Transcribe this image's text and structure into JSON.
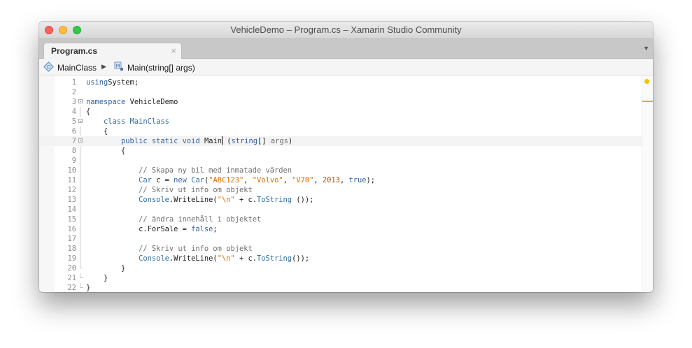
{
  "window": {
    "title": "VehicleDemo – Program.cs – Xamarin Studio Community"
  },
  "tabs": [
    {
      "label": "Program.cs",
      "close": "×"
    }
  ],
  "tab_overflow": "▼",
  "pathbar": {
    "class_name": "MainClass",
    "separator": "▶",
    "method_name": "Main(string[] args)"
  },
  "colors": {
    "keyword": "#3364a4",
    "string": "#db7100",
    "comment": "#6f6f6f",
    "line_number": "#8f8f8f"
  },
  "icons": [
    "close-icon",
    "minimize-icon",
    "zoom-icon",
    "class-icon",
    "method-icon",
    "fold-icon",
    "chevron-down-icon"
  ],
  "editor": {
    "cursor_line": 7,
    "lines": [
      {
        "n": "1",
        "tokens": [
          [
            "kw",
            "using"
          ],
          [
            "",
            "System;"
          ]
        ]
      },
      {
        "n": "2",
        "tokens": []
      },
      {
        "n": "3",
        "tokens": [
          [
            "kw",
            "namespace"
          ],
          [
            "",
            " VehicleDemo"
          ]
        ]
      },
      {
        "n": "4",
        "tokens": [
          [
            "",
            "{"
          ]
        ]
      },
      {
        "n": "5",
        "tokens": [
          [
            "",
            "    "
          ],
          [
            "kw",
            "class"
          ],
          [
            "",
            " "
          ],
          [
            "ty",
            "MainClass"
          ]
        ]
      },
      {
        "n": "6",
        "tokens": [
          [
            "",
            "    {"
          ]
        ]
      },
      {
        "n": "7",
        "tokens": [
          [
            "",
            "        "
          ],
          [
            "kw",
            "public"
          ],
          [
            "",
            " "
          ],
          [
            "kw",
            "static"
          ],
          [
            "",
            " "
          ],
          [
            "kw",
            "void"
          ],
          [
            "",
            " Main"
          ],
          [
            "caret",
            ""
          ],
          [
            "",
            " ("
          ],
          [
            "kw",
            "string"
          ],
          [
            "",
            "[] "
          ],
          [
            "cm",
            "args"
          ],
          [
            "",
            ")"
          ]
        ]
      },
      {
        "n": "8",
        "tokens": [
          [
            "",
            "        {"
          ]
        ]
      },
      {
        "n": "9",
        "tokens": []
      },
      {
        "n": "10",
        "tokens": [
          [
            "",
            "            "
          ],
          [
            "cm",
            "// Skapa ny bil med inmatade värden"
          ]
        ]
      },
      {
        "n": "11",
        "tokens": [
          [
            "",
            "            "
          ],
          [
            "ty",
            "Car"
          ],
          [
            "",
            " c = "
          ],
          [
            "kw",
            "new"
          ],
          [
            "",
            " "
          ],
          [
            "ty",
            "Car"
          ],
          [
            "",
            "("
          ],
          [
            "st",
            "\"ABC123\""
          ],
          [
            "",
            ", "
          ],
          [
            "st",
            "\"Volvo\""
          ],
          [
            "",
            ", "
          ],
          [
            "st",
            "\"V70\""
          ],
          [
            "",
            ", "
          ],
          [
            "nu",
            "2013"
          ],
          [
            "",
            ", "
          ],
          [
            "kw",
            "true"
          ],
          [
            "",
            ");"
          ]
        ]
      },
      {
        "n": "12",
        "tokens": [
          [
            "",
            "            "
          ],
          [
            "cm",
            "// Skriv ut info om objekt"
          ]
        ]
      },
      {
        "n": "13",
        "tokens": [
          [
            "",
            "            "
          ],
          [
            "ty",
            "Console"
          ],
          [
            "",
            ".WriteLine("
          ],
          [
            "st",
            "\"\\n\""
          ],
          [
            "",
            " + c."
          ],
          [
            "ty",
            "ToString"
          ],
          [
            "",
            " ());"
          ]
        ]
      },
      {
        "n": "14",
        "tokens": []
      },
      {
        "n": "15",
        "tokens": [
          [
            "",
            "            "
          ],
          [
            "cm",
            "// ändra innehåll i objektet"
          ]
        ]
      },
      {
        "n": "16",
        "tokens": [
          [
            "",
            "            c.ForSale = "
          ],
          [
            "kw",
            "false"
          ],
          [
            "",
            ";"
          ]
        ]
      },
      {
        "n": "17",
        "tokens": []
      },
      {
        "n": "18",
        "tokens": [
          [
            "",
            "            "
          ],
          [
            "cm",
            "// Skriv ut info om objekt"
          ]
        ]
      },
      {
        "n": "19",
        "tokens": [
          [
            "",
            "            "
          ],
          [
            "ty",
            "Console"
          ],
          [
            "",
            ".WriteLine("
          ],
          [
            "st",
            "\"\\n\""
          ],
          [
            "",
            " + c."
          ],
          [
            "ty",
            "ToString"
          ],
          [
            "",
            "());"
          ]
        ]
      },
      {
        "n": "20",
        "tokens": [
          [
            "",
            "        }"
          ]
        ]
      },
      {
        "n": "21",
        "tokens": [
          [
            "",
            "    }"
          ]
        ]
      },
      {
        "n": "22",
        "tokens": [
          [
            "",
            "}"
          ]
        ]
      }
    ]
  }
}
